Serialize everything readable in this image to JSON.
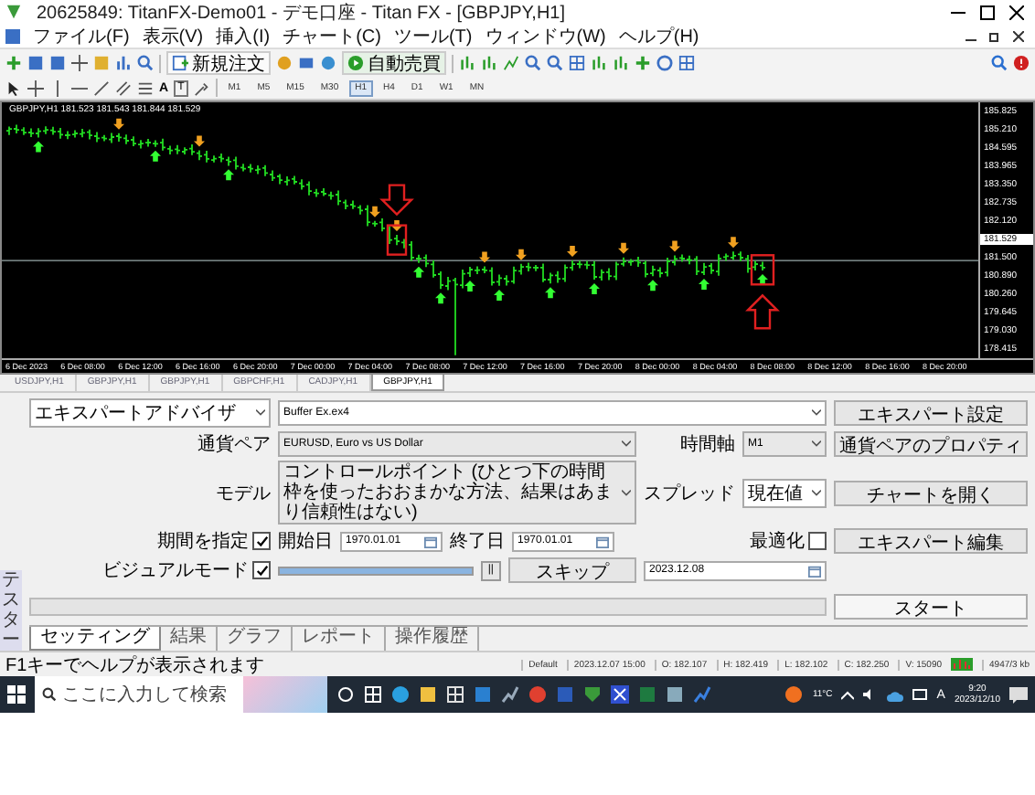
{
  "window": {
    "title": "20625849: TitanFX-Demo01 - デモ口座 - Titan FX - [GBPJPY,H1]"
  },
  "menu": [
    "ファイル(F)",
    "表示(V)",
    "挿入(I)",
    "チャート(C)",
    "ツール(T)",
    "ウィンドウ(W)",
    "ヘルプ(H)"
  ],
  "toolbar": {
    "new_order": "新規注文",
    "auto_trading": "自動売買"
  },
  "drawing_tools": {
    "text": "A",
    "label": "T"
  },
  "timeframes": [
    {
      "label": "M1",
      "selected": false
    },
    {
      "label": "M5",
      "selected": false
    },
    {
      "label": "M15",
      "selected": false
    },
    {
      "label": "M30",
      "selected": false
    },
    {
      "label": "H1",
      "selected": true
    },
    {
      "label": "H4",
      "selected": false
    },
    {
      "label": "D1",
      "selected": false
    },
    {
      "label": "W1",
      "selected": false
    },
    {
      "label": "MN",
      "selected": false
    }
  ],
  "chart": {
    "header": "GBPJPY,H1  181.523 181.543 181.844 181.529",
    "price_labels": [
      {
        "text": "185.825",
        "current": false
      },
      {
        "text": "185.210",
        "current": false
      },
      {
        "text": "184.595",
        "current": false
      },
      {
        "text": "183.965",
        "current": false
      },
      {
        "text": "183.350",
        "current": false
      },
      {
        "text": "182.735",
        "current": false
      },
      {
        "text": "182.120",
        "current": false
      },
      {
        "text": "181.529",
        "current": true
      },
      {
        "text": "181.500",
        "current": false
      },
      {
        "text": "180.890",
        "current": false
      },
      {
        "text": "180.260",
        "current": false
      },
      {
        "text": "179.645",
        "current": false
      },
      {
        "text": "179.030",
        "current": false
      },
      {
        "text": "178.415",
        "current": false
      }
    ],
    "time_labels": [
      "6 Dec 2023",
      "6 Dec 08:00",
      "6 Dec 12:00",
      "6 Dec 16:00",
      "6 Dec 20:00",
      "7 Dec 00:00",
      "7 Dec 04:00",
      "7 Dec 08:00",
      "7 Dec 12:00",
      "7 Dec 16:00",
      "7 Dec 20:00",
      "8 Dec 00:00",
      "8 Dec 04:00",
      "8 Dec 08:00",
      "8 Dec 12:00",
      "8 Dec 16:00",
      "8 Dec 20:00"
    ]
  },
  "chart_tabs": [
    {
      "label": "USDJPY,H1",
      "selected": false
    },
    {
      "label": "GBPJPY,H1",
      "selected": false
    },
    {
      "label": "GBPJPY,H1",
      "selected": false
    },
    {
      "label": "GBPCHF,H1",
      "selected": false
    },
    {
      "label": "CADJPY,H1",
      "selected": false
    },
    {
      "label": "GBPJPY,H1",
      "selected": true
    }
  ],
  "tester": {
    "side_label": "テスター",
    "expert_type": "エキスパートアドバイザ",
    "expert": "Buffer Ex.ex4",
    "symbol_label": "通貨ペア",
    "symbol": "EURUSD, Euro vs US Dollar",
    "period_label": "時間軸",
    "period": "M1",
    "model_label": "モデル",
    "model": "コントロールポイント (ひとつ下の時間枠を使ったおおまかな方法、結果はあまり信頼性はない)",
    "spread_label": "スプレッド",
    "spread": "現在値",
    "use_date": {
      "label": "期間を指定",
      "checked": true
    },
    "from_label": "開始日",
    "from": "1970.01.01",
    "to_label": "終了日",
    "to": "1970.01.01",
    "optimization": {
      "label": "最適化",
      "checked": false
    },
    "visual": {
      "label": "ビジュアルモード",
      "checked": true
    },
    "speed": {
      "level": 1
    },
    "pause": "||",
    "skip": "スキップ",
    "skip_to": "2023.12.08",
    "progress": {
      "level": 0
    },
    "buttons": [
      "エキスパート設定",
      "通貨ペアのプロパティ",
      "チャートを開く",
      "エキスパート編集"
    ],
    "start": "スタート",
    "tabs": [
      {
        "label": "セッティング",
        "selected": true
      },
      {
        "label": "結果",
        "selected": false
      },
      {
        "label": "グラフ",
        "selected": false
      },
      {
        "label": "レポート",
        "selected": false
      },
      {
        "label": "操作履歴",
        "selected": false
      }
    ]
  },
  "status_bar": {
    "help": "F1キーでヘルプが表示されます",
    "profile": "Default",
    "time": "2023.12.07 15:00",
    "open": "O: 182.107",
    "high": "H: 182.419",
    "low": "L: 182.102",
    "close": "C: 182.250",
    "volume": "V: 15090",
    "traffic": "4947/3 kb"
  },
  "taskbar": {
    "search_placeholder": "ここに入力して検索",
    "temperature": "11°C",
    "ime": "A",
    "time": "9:20",
    "date": "2023/12/10"
  }
}
